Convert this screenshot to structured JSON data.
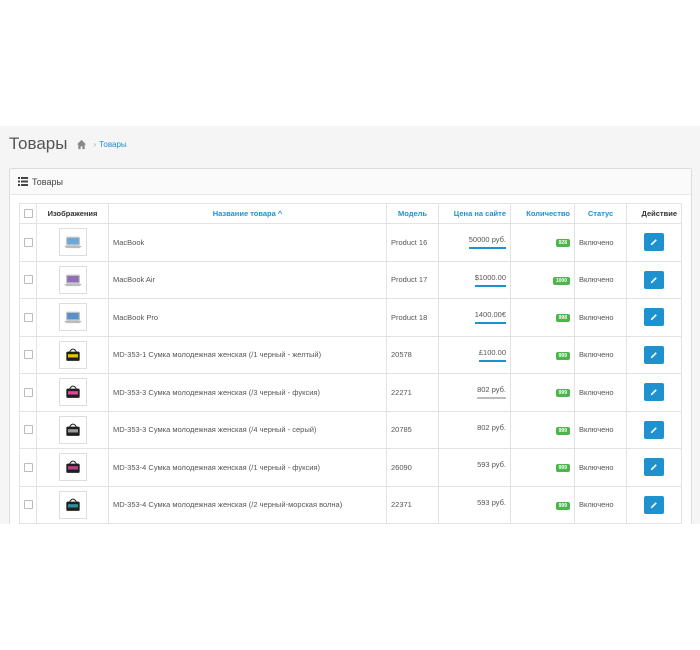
{
  "page": {
    "title": "Товары"
  },
  "breadcrumb": {
    "items": [
      {
        "label": "Товары"
      }
    ]
  },
  "panel": {
    "title": "Товары"
  },
  "table": {
    "headers": {
      "image": "Изображения",
      "name": "Название товара ^",
      "model": "Модель",
      "price": "Цена на сайте",
      "quantity": "Количество",
      "status": "Статус",
      "action": "Действие"
    },
    "rows": [
      {
        "image": "laptop-white",
        "name": "MacBook",
        "model": "Product 16",
        "price": "50000 руб.",
        "price_line": "#1e91cf",
        "qty": "928",
        "status": "Включено"
      },
      {
        "image": "laptop-air",
        "name": "MacBook Air",
        "model": "Product 17",
        "price": "$1000.00",
        "price_line": "#1e91cf",
        "qty": "1000",
        "status": "Включено"
      },
      {
        "image": "laptop-pro",
        "name": "MacBook Pro",
        "model": "Product 18",
        "price": "1400.00€",
        "price_line": "#1e91cf",
        "qty": "998",
        "status": "Включено"
      },
      {
        "image": "bag-yellow",
        "name": "MD-353-1 Сумка молодежная женская (/1 черный - желтый)",
        "model": "20578",
        "price": "£100.00",
        "price_line": "#1e91cf",
        "qty": "999",
        "status": "Включено"
      },
      {
        "image": "bag-pink",
        "name": "MD-353-3 Сумка молодежная женская (/3 черный - фуксия)",
        "model": "22271",
        "price": "802 руб.",
        "price_line": "#bbbbbb",
        "qty": "999",
        "status": "Включено"
      },
      {
        "image": "bag-grey",
        "name": "MD-353-3 Сумка молодежная женская (/4 черный - серый)",
        "model": "20785",
        "price": "802 руб.",
        "price_line": "",
        "qty": "999",
        "status": "Включено"
      },
      {
        "image": "bag-fuchsia",
        "name": "MD-353-4 Сумка молодежная женская (/1 черный - фуксия)",
        "model": "26090",
        "price": "593 руб.",
        "price_line": "",
        "qty": "999",
        "status": "Включено"
      },
      {
        "image": "bag-teal",
        "name": "MD-353-4 Сумка молодежная женская (/2 черный-морская волна)",
        "model": "22371",
        "price": "593 руб.",
        "price_line": "",
        "qty": "999",
        "status": "Включено"
      }
    ]
  },
  "colors": {
    "accent": "#1e91cf",
    "badge": "#4cb64c",
    "page_bg": "#f5f5f5"
  }
}
